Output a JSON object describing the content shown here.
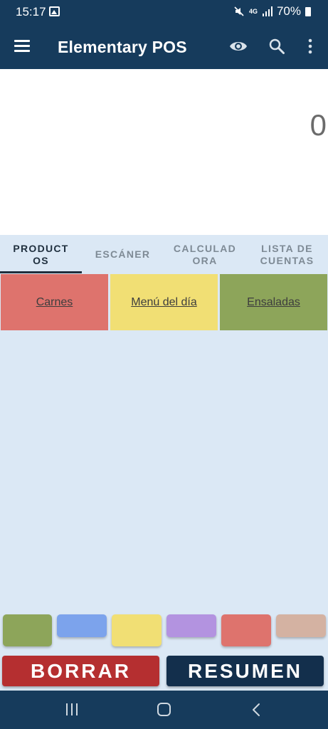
{
  "status_bar": {
    "time": "15:17",
    "network": "4G",
    "battery": "70%",
    "icons": [
      "image-icon",
      "mute-icon",
      "4g-icon",
      "signal-icon",
      "battery-icon"
    ]
  },
  "app_bar": {
    "title": "Elementary POS",
    "icons": [
      "menu-icon",
      "eye-icon",
      "search-icon",
      "more-vert-icon"
    ]
  },
  "display": {
    "value": "0"
  },
  "tabs": [
    {
      "label": "PRODUCTOS",
      "line1": "PRODUCT",
      "line2": "OS",
      "active": true
    },
    {
      "label": "ESCÁNER",
      "line1": "ESCÁNER",
      "line2": "",
      "active": false
    },
    {
      "label": "CALCULADORA",
      "line1": "CALCULAD",
      "line2": "ORA",
      "active": false
    },
    {
      "label": "LISTA DE CUENTAS",
      "line1": "LISTA DE",
      "line2": "CUENTAS",
      "active": false
    }
  ],
  "categories": [
    {
      "label": "Carnes",
      "color": "#de736d"
    },
    {
      "label": "Menú del día",
      "color": "#f1df74"
    },
    {
      "label": "Ensaladas",
      "color": "#8da55a"
    }
  ],
  "color_palette": [
    "#8da55a",
    "#7ca3ec",
    "#f1df74",
    "#b393e0",
    "#de736d",
    "#d4b2a2"
  ],
  "buttons": {
    "clear": {
      "label": "BORRAR",
      "color": "#b52f30"
    },
    "summary": {
      "label": "RESUMEN",
      "color": "#132f4c"
    }
  },
  "nav_bar": {
    "icons": [
      "recent-apps-icon",
      "home-icon",
      "back-icon"
    ]
  }
}
